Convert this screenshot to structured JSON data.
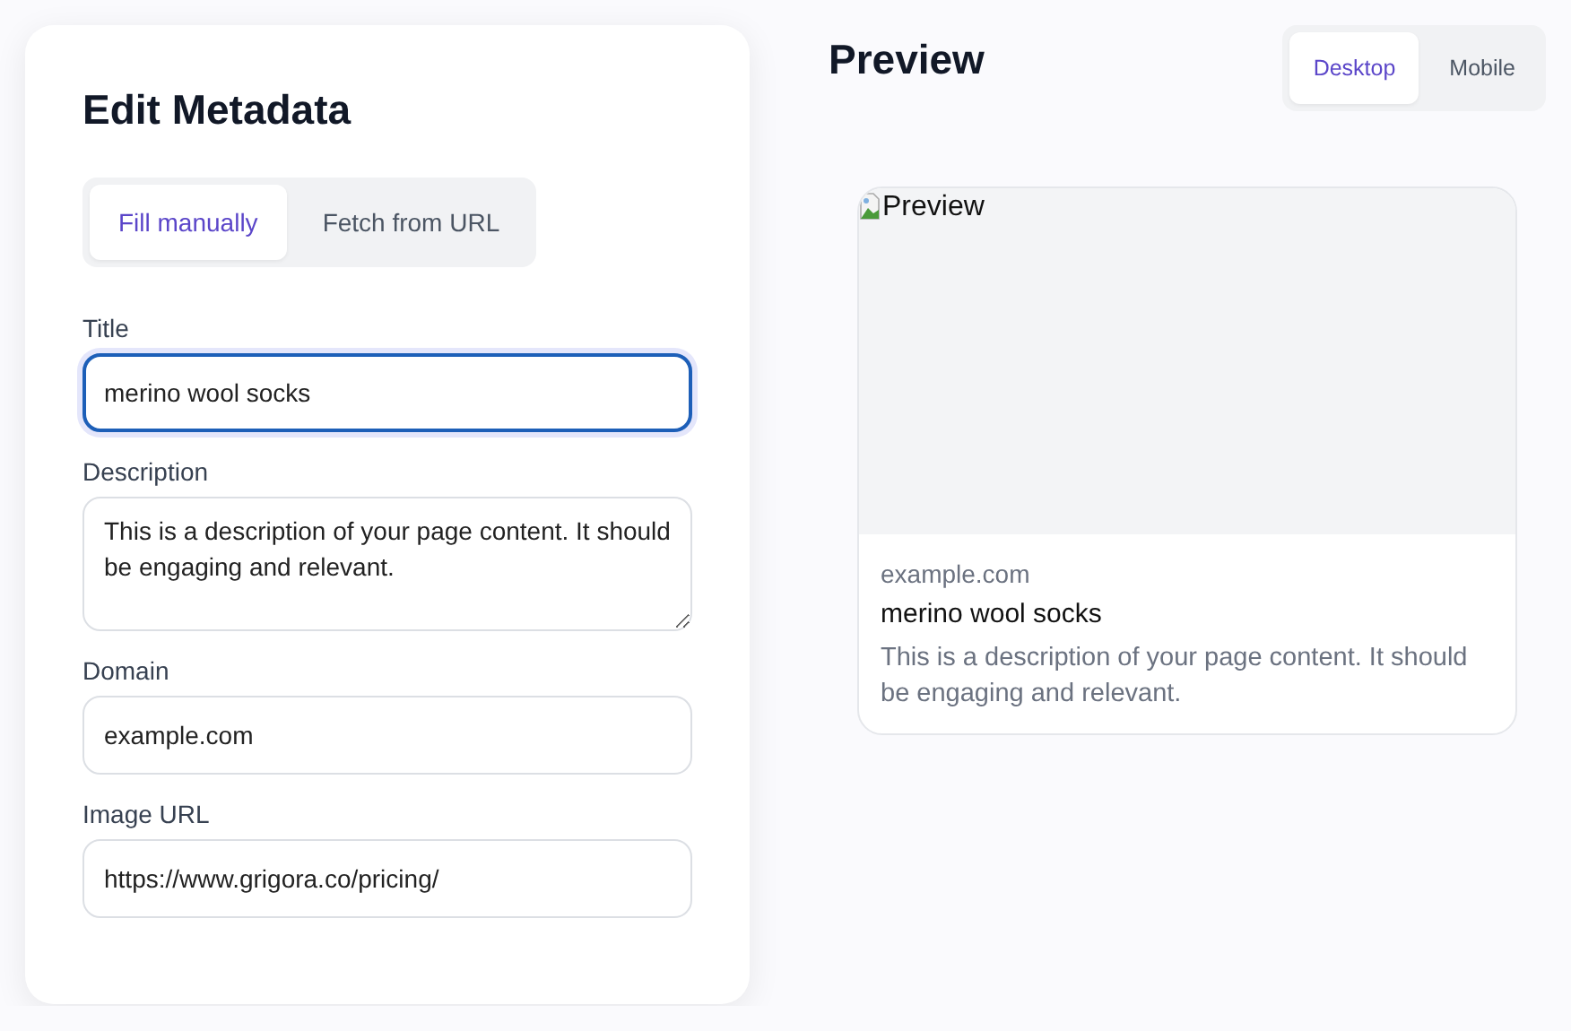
{
  "editor": {
    "heading": "Edit Metadata",
    "modes": [
      {
        "label": "Fill manually",
        "selected": true
      },
      {
        "label": "Fetch from URL",
        "selected": false
      }
    ],
    "fields": [
      {
        "kind": "input",
        "label": "Title",
        "value": "merino wool socks",
        "focused": true
      },
      {
        "kind": "textarea",
        "label": "Description",
        "value": "This is a description of your page content. It should be engaging and relevant.",
        "focused": false
      },
      {
        "kind": "input",
        "label": "Domain",
        "value": "example.com",
        "focused": false
      },
      {
        "kind": "input",
        "label": "Image URL",
        "value": "https://www.grigora.co/pricing/",
        "focused": false
      }
    ]
  },
  "preview": {
    "heading": "Preview",
    "devices": [
      {
        "label": "Desktop",
        "selected": true
      },
      {
        "label": "Mobile",
        "selected": false
      }
    ],
    "card": {
      "image_alt": "Preview",
      "domain": "example.com",
      "title": "merino wool socks",
      "description": "This is a description of your page content. It should be engaging and relevant."
    }
  }
}
